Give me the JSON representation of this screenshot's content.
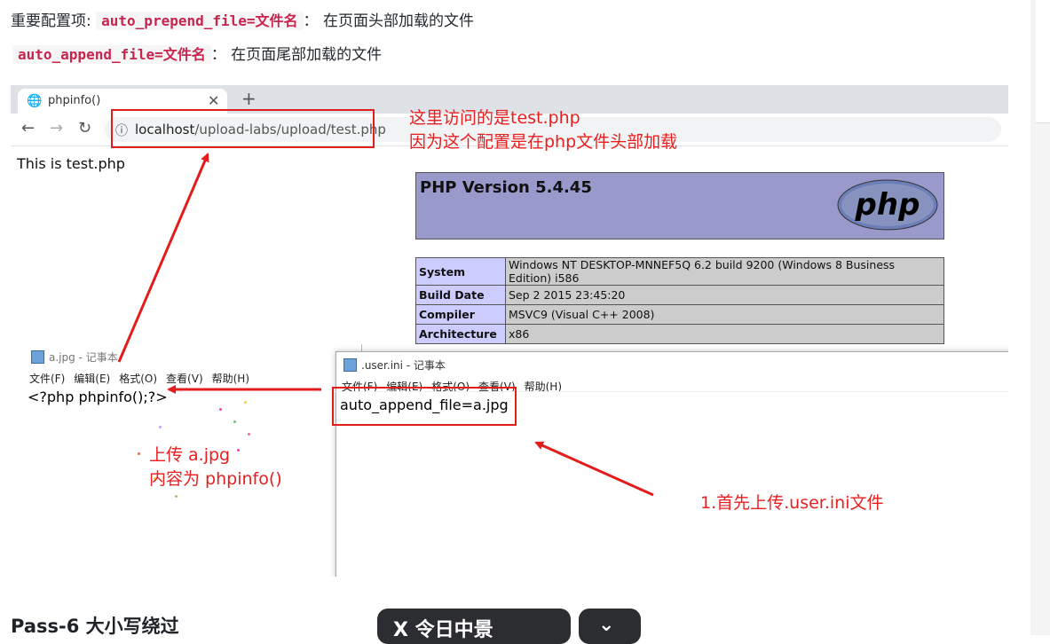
{
  "article": {
    "line1_prefix": "重要配置项: ",
    "line1_code": "auto_prepend_file=文件名",
    "line1_suffix": "： 在页面头部加载的文件",
    "line2_code": "auto_append_file=文件名",
    "line2_suffix": "： 在页面尾部加载的文件",
    "next_heading": "Pass-6 大小写绕过",
    "fab_label": "X 令日中景",
    "fab2_label": "⌄"
  },
  "browser": {
    "tab_title": "phpinfo()",
    "tab_close": "✕",
    "new_tab": "+",
    "back": "←",
    "forward": "→",
    "reload": "↻",
    "info_icon": "ⓘ",
    "url_host": "localhost",
    "url_path": "/upload-labs/upload/test.php",
    "page_text": "This is test.php"
  },
  "phpinfo": {
    "version": "PHP Version 5.4.45",
    "logo_text": "php",
    "rows": [
      {
        "k": "System",
        "v": "Windows NT DESKTOP-MNNEF5Q 6.2 build 9200 (Windows 8 Business Edition) i586"
      },
      {
        "k": "Build Date",
        "v": "Sep 2 2015 23:45:20"
      },
      {
        "k": "Compiler",
        "v": "MSVC9 (Visual C++ 2008)"
      },
      {
        "k": "Architecture",
        "v": "x86"
      }
    ]
  },
  "annotations": {
    "top_line1": "这里访问的是test.php",
    "top_line2": "因为这个配置是在php文件头部加载",
    "upload_line1": "上传 a.jpg",
    "upload_line2": "内容为 phpinfo()",
    "first_upload": "1.首先上传.user.ini文件"
  },
  "notepad_a": {
    "title": "a.jpg - 记事本",
    "menu": [
      "文件(F)",
      "编辑(E)",
      "格式(O)",
      "查看(V)",
      "帮助(H)"
    ],
    "content": "<?php phpinfo();?>"
  },
  "notepad_ini": {
    "title": ".user.ini - 记事本",
    "menu": [
      "文件(F)",
      "编辑(E)",
      "格式(O)",
      "查看(V)",
      "帮助(H)"
    ],
    "content": "auto_append_file=a.jpg"
  },
  "colors": {
    "annotation_red": "#ea1e1e",
    "code_pink": "#c7254e",
    "php_purple": "#9999cc"
  }
}
